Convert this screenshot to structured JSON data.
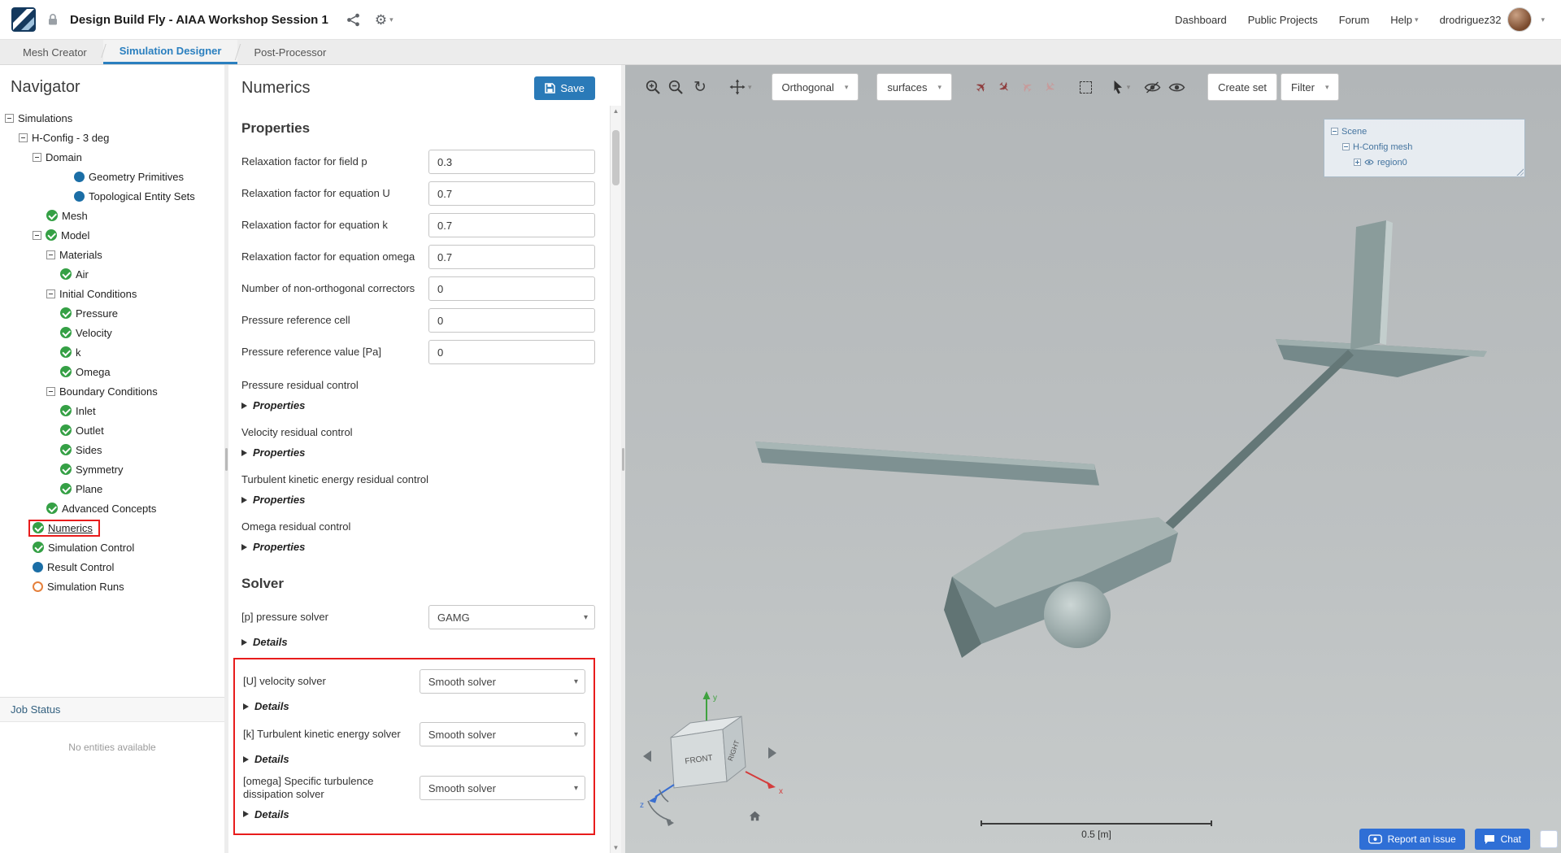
{
  "colors": {
    "accent_blue": "#2a7ab8",
    "active_tab_blue": "#2a7fbf",
    "annotation_red": "#e81c1c",
    "check_green": "#35a045",
    "status_dot_blue": "#1b6ea6",
    "pending_orange": "#e5803c",
    "scene_link_blue": "#44749f",
    "bottom_button_blue": "#2f6fd6",
    "plane_icon_maroon": "#8e3b3b"
  },
  "header": {
    "project_title": "Design Build Fly - AIAA Workshop Session 1",
    "nav_items": [
      {
        "label": "Dashboard",
        "caret": false
      },
      {
        "label": "Public Projects",
        "caret": false
      },
      {
        "label": "Forum",
        "caret": false
      },
      {
        "label": "Help",
        "caret": true
      }
    ],
    "username": "drodriguez32"
  },
  "tabs": [
    {
      "label": "Mesh Creator",
      "active": false
    },
    {
      "label": "Simulation Designer",
      "active": true
    },
    {
      "label": "Post-Processor",
      "active": false
    }
  ],
  "navigator": {
    "title": "Navigator",
    "tree": [
      {
        "label": "Simulations",
        "indent": 0,
        "expander": true,
        "icon": "none"
      },
      {
        "label": "H-Config - 3 deg",
        "indent": 1,
        "expander": true,
        "icon": "none"
      },
      {
        "label": "Domain",
        "indent": 2,
        "expander": true,
        "icon": "none"
      },
      {
        "label": "Geometry Primitives",
        "indent": 5,
        "expander": false,
        "icon": "blue-dot"
      },
      {
        "label": "Topological Entity Sets",
        "indent": 5,
        "expander": false,
        "icon": "blue-dot"
      },
      {
        "label": "Mesh",
        "indent": 3,
        "expander": false,
        "icon": "check"
      },
      {
        "label": "Model",
        "indent": 2,
        "expander": true,
        "icon": "check"
      },
      {
        "label": "Materials",
        "indent": 3,
        "expander": true,
        "icon": "none"
      },
      {
        "label": "Air",
        "indent": 4,
        "expander": false,
        "icon": "check"
      },
      {
        "label": "Initial Conditions",
        "indent": 3,
        "expander": true,
        "icon": "none"
      },
      {
        "label": "Pressure",
        "indent": 4,
        "expander": false,
        "icon": "check"
      },
      {
        "label": "Velocity",
        "indent": 4,
        "expander": false,
        "icon": "check"
      },
      {
        "label": "k",
        "indent": 4,
        "expander": false,
        "icon": "check"
      },
      {
        "label": "Omega",
        "indent": 4,
        "expander": false,
        "icon": "check"
      },
      {
        "label": "Boundary Conditions",
        "indent": 3,
        "expander": true,
        "icon": "none"
      },
      {
        "label": "Inlet",
        "indent": 4,
        "expander": false,
        "icon": "check"
      },
      {
        "label": "Outlet",
        "indent": 4,
        "expander": false,
        "icon": "check"
      },
      {
        "label": "Sides",
        "indent": 4,
        "expander": false,
        "icon": "check"
      },
      {
        "label": "Symmetry",
        "indent": 4,
        "expander": false,
        "icon": "check"
      },
      {
        "label": "Plane",
        "indent": 4,
        "expander": false,
        "icon": "check"
      },
      {
        "label": "Advanced Concepts",
        "indent": 3,
        "expander": false,
        "icon": "check"
      },
      {
        "label": "Numerics",
        "indent": 2,
        "expander": false,
        "icon": "check",
        "selected": true
      },
      {
        "label": "Simulation Control",
        "indent": 2,
        "expander": false,
        "icon": "check"
      },
      {
        "label": "Result Control",
        "indent": 2,
        "expander": false,
        "icon": "blue-dot"
      },
      {
        "label": "Simulation Runs",
        "indent": 2,
        "expander": false,
        "icon": "orange-circle"
      }
    ],
    "job_status": {
      "title": "Job Status",
      "empty_text": "No entities available"
    }
  },
  "panel": {
    "title": "Numerics",
    "save_label": "Save",
    "sections": {
      "properties_title": "Properties",
      "solver_title": "Solver"
    },
    "fields": [
      {
        "label": "Relaxation factor for field p",
        "value": "0.3"
      },
      {
        "label": "Relaxation factor for equation U",
        "value": "0.7"
      },
      {
        "label": "Relaxation factor for equation k",
        "value": "0.7"
      },
      {
        "label": "Relaxation factor for equation omega",
        "value": "0.7"
      },
      {
        "label": "Number of non-orthogonal correctors",
        "value": "0"
      },
      {
        "label": "Pressure reference cell",
        "value": "0"
      },
      {
        "label": "Pressure reference value [Pa]",
        "value": "0"
      }
    ],
    "residual_groups": [
      {
        "label": "Pressure residual control",
        "toggle": "Properties"
      },
      {
        "label": "Velocity residual control",
        "toggle": "Properties"
      },
      {
        "label": "Turbulent kinetic energy residual control",
        "toggle": "Properties"
      },
      {
        "label": "Omega residual control",
        "toggle": "Properties"
      }
    ],
    "solvers": [
      {
        "label": "[p] pressure solver",
        "value": "GAMG",
        "toggle": "Details",
        "highlighted": false
      },
      {
        "label": "[U] velocity solver",
        "value": "Smooth solver",
        "toggle": "Details",
        "highlighted": true
      },
      {
        "label": "[k] Turbulent kinetic energy solver",
        "value": "Smooth solver",
        "toggle": "Details",
        "highlighted": true
      },
      {
        "label": "[omega] Specific turbulence dissipation solver",
        "value": "Smooth solver",
        "toggle": "Details",
        "highlighted": true
      }
    ]
  },
  "viewport": {
    "toolbar": {
      "orthogonal_label": "Orthogonal",
      "surfaces_label": "surfaces",
      "create_set_label": "Create set",
      "filter_label": "Filter"
    },
    "scene_tree": {
      "root_label": "Scene",
      "mesh_label": "H-Config mesh",
      "region_label": "region0"
    },
    "nav_cube": {
      "front_label": "FRONT",
      "right_label": "RIGHT",
      "axis_x": "x",
      "axis_y": "y",
      "axis_z": "z"
    },
    "scale_bar_label": "0.5 [m]",
    "report_issue_label": "Report an issue",
    "chat_label": "Chat"
  }
}
